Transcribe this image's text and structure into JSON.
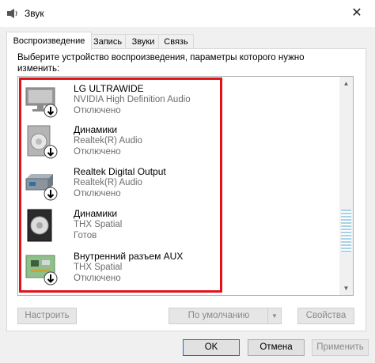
{
  "window": {
    "title": "Звук",
    "close_symbol": "✕"
  },
  "tabs": [
    {
      "label": "Воспроизведение",
      "active": true
    },
    {
      "label": "Запись",
      "active": false
    },
    {
      "label": "Звуки",
      "active": false
    },
    {
      "label": "Связь",
      "active": false
    }
  ],
  "instruction": "Выберите устройство воспроизведения, параметры которого нужно изменить:",
  "devices": [
    {
      "name": "LG ULTRAWIDE",
      "driver": "NVIDIA High Definition Audio",
      "status": "Отключено",
      "icon": "monitor-icon",
      "disabled": true
    },
    {
      "name": "Динамики",
      "driver": "Realtek(R) Audio",
      "status": "Отключено",
      "icon": "speaker-icon",
      "disabled": true
    },
    {
      "name": "Realtek Digital Output",
      "driver": "Realtek(R) Audio",
      "status": "Отключено",
      "icon": "digital-output-icon",
      "disabled": true
    },
    {
      "name": "Динамики",
      "driver": "THX Spatial",
      "status": "Готов",
      "icon": "speaker-icon",
      "disabled": false
    },
    {
      "name": "Внутренний разъем  AUX",
      "driver": "THX Spatial",
      "status": "Отключено",
      "icon": "circuit-board-icon",
      "disabled": true
    }
  ],
  "buttons": {
    "configure": "Настроить",
    "default": "По умолчанию",
    "properties": "Свойства",
    "ok": "OK",
    "cancel": "Отмена",
    "apply": "Применить"
  },
  "colors": {
    "highlight_border": "#e1121a",
    "accent": "#0078d7"
  }
}
